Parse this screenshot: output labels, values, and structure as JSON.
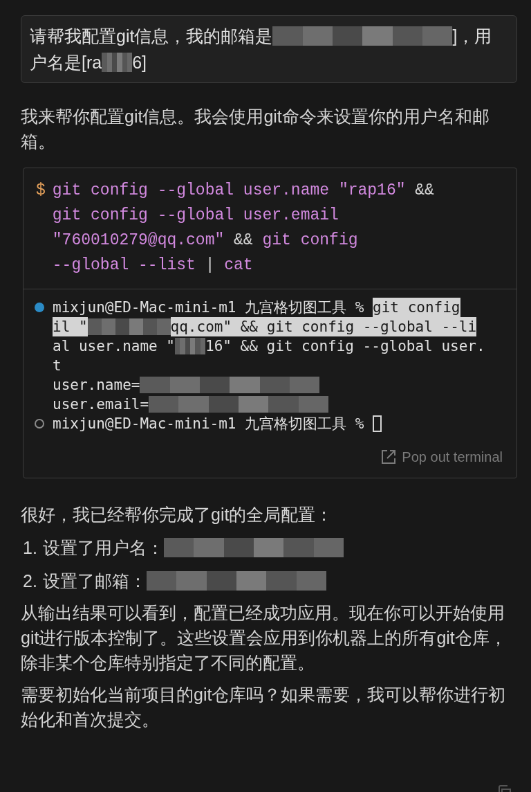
{
  "user_message": {
    "lines": [
      [
        {
          "kind": "text",
          "text": "请帮我配置git信息，我的邮箱是"
        },
        {
          "kind": "redacted_long"
        },
        {
          "kind": "text",
          "text": "]，用"
        }
      ],
      [
        {
          "kind": "text",
          "text": "户名是[ra"
        },
        {
          "kind": "redacted_short"
        },
        {
          "kind": "text",
          "text": "6]"
        }
      ]
    ]
  },
  "intro": "我来帮你配置git信息。我会使用git命令来设置你的用户名和邮箱。",
  "code_block": {
    "prompt": "$",
    "lines": [
      [
        {
          "kind": "cmd",
          "text": "git config --global user.name \"rap16\" "
        },
        {
          "kind": "op",
          "text": "&&"
        }
      ],
      [
        {
          "kind": "cmd",
          "text": "git config --global user.email"
        }
      ],
      [
        {
          "kind": "cmd",
          "text": "\"760010279@qq.com\" "
        },
        {
          "kind": "op",
          "text": "&& "
        },
        {
          "kind": "cmd",
          "text": "git config"
        }
      ],
      [
        {
          "kind": "cmd",
          "text": "--global --list "
        },
        {
          "kind": "op",
          "text": "| "
        },
        {
          "kind": "cmd",
          "text": "cat"
        }
      ]
    ]
  },
  "terminal": {
    "lines": [
      {
        "active": true,
        "parts": [
          {
            "kind": "text",
            "text": "mixjun@ED-Mac-mini-m1 九宫格切图工具 % "
          },
          {
            "kind": "selected",
            "text": "git config"
          }
        ]
      },
      {
        "parts": [
          {
            "kind": "selected",
            "text": "il \""
          },
          {
            "kind": "redacted_mid"
          },
          {
            "kind": "selected",
            "text": "qq.com\" && git config --global --li"
          }
        ]
      },
      {
        "parts": [
          {
            "kind": "text",
            "text": "al user.name \""
          },
          {
            "kind": "redacted_short"
          },
          {
            "kind": "text",
            "text": "16\" && git config --global user."
          }
        ]
      },
      {
        "parts": [
          {
            "kind": "text",
            "text": "t"
          }
        ]
      },
      {
        "parts": [
          {
            "kind": "text",
            "text": "user.name="
          },
          {
            "kind": "redacted_long"
          }
        ]
      },
      {
        "parts": [
          {
            "kind": "text",
            "text": "user.email="
          },
          {
            "kind": "redacted_long"
          }
        ]
      },
      {
        "active": false,
        "cursor": true,
        "parts": [
          {
            "kind": "text",
            "text": "mixjun@ED-Mac-mini-m1 九宫格切图工具 % "
          }
        ]
      }
    ],
    "pop_out_label": "Pop out terminal"
  },
  "summary": "很好，我已经帮你完成了git的全局配置：",
  "list": [
    {
      "number": "1.",
      "parts": [
        {
          "kind": "text",
          "text": "设置了用户名："
        },
        {
          "kind": "redacted_long"
        }
      ]
    },
    {
      "number": "2.",
      "parts": [
        {
          "kind": "text",
          "text": "设置了邮箱："
        },
        {
          "kind": "redacted_long"
        }
      ]
    }
  ],
  "paragraphs": [
    "从输出结果可以看到，配置已经成功应用。现在你可以开始使用git进行版本控制了。这些设置会应用到你机器上的所有git仓库，除非某个仓库特别指定了不同的配置。",
    "需要初始化当前项目的git仓库吗？如果需要，我可以帮你进行初始化和首次提交。"
  ]
}
